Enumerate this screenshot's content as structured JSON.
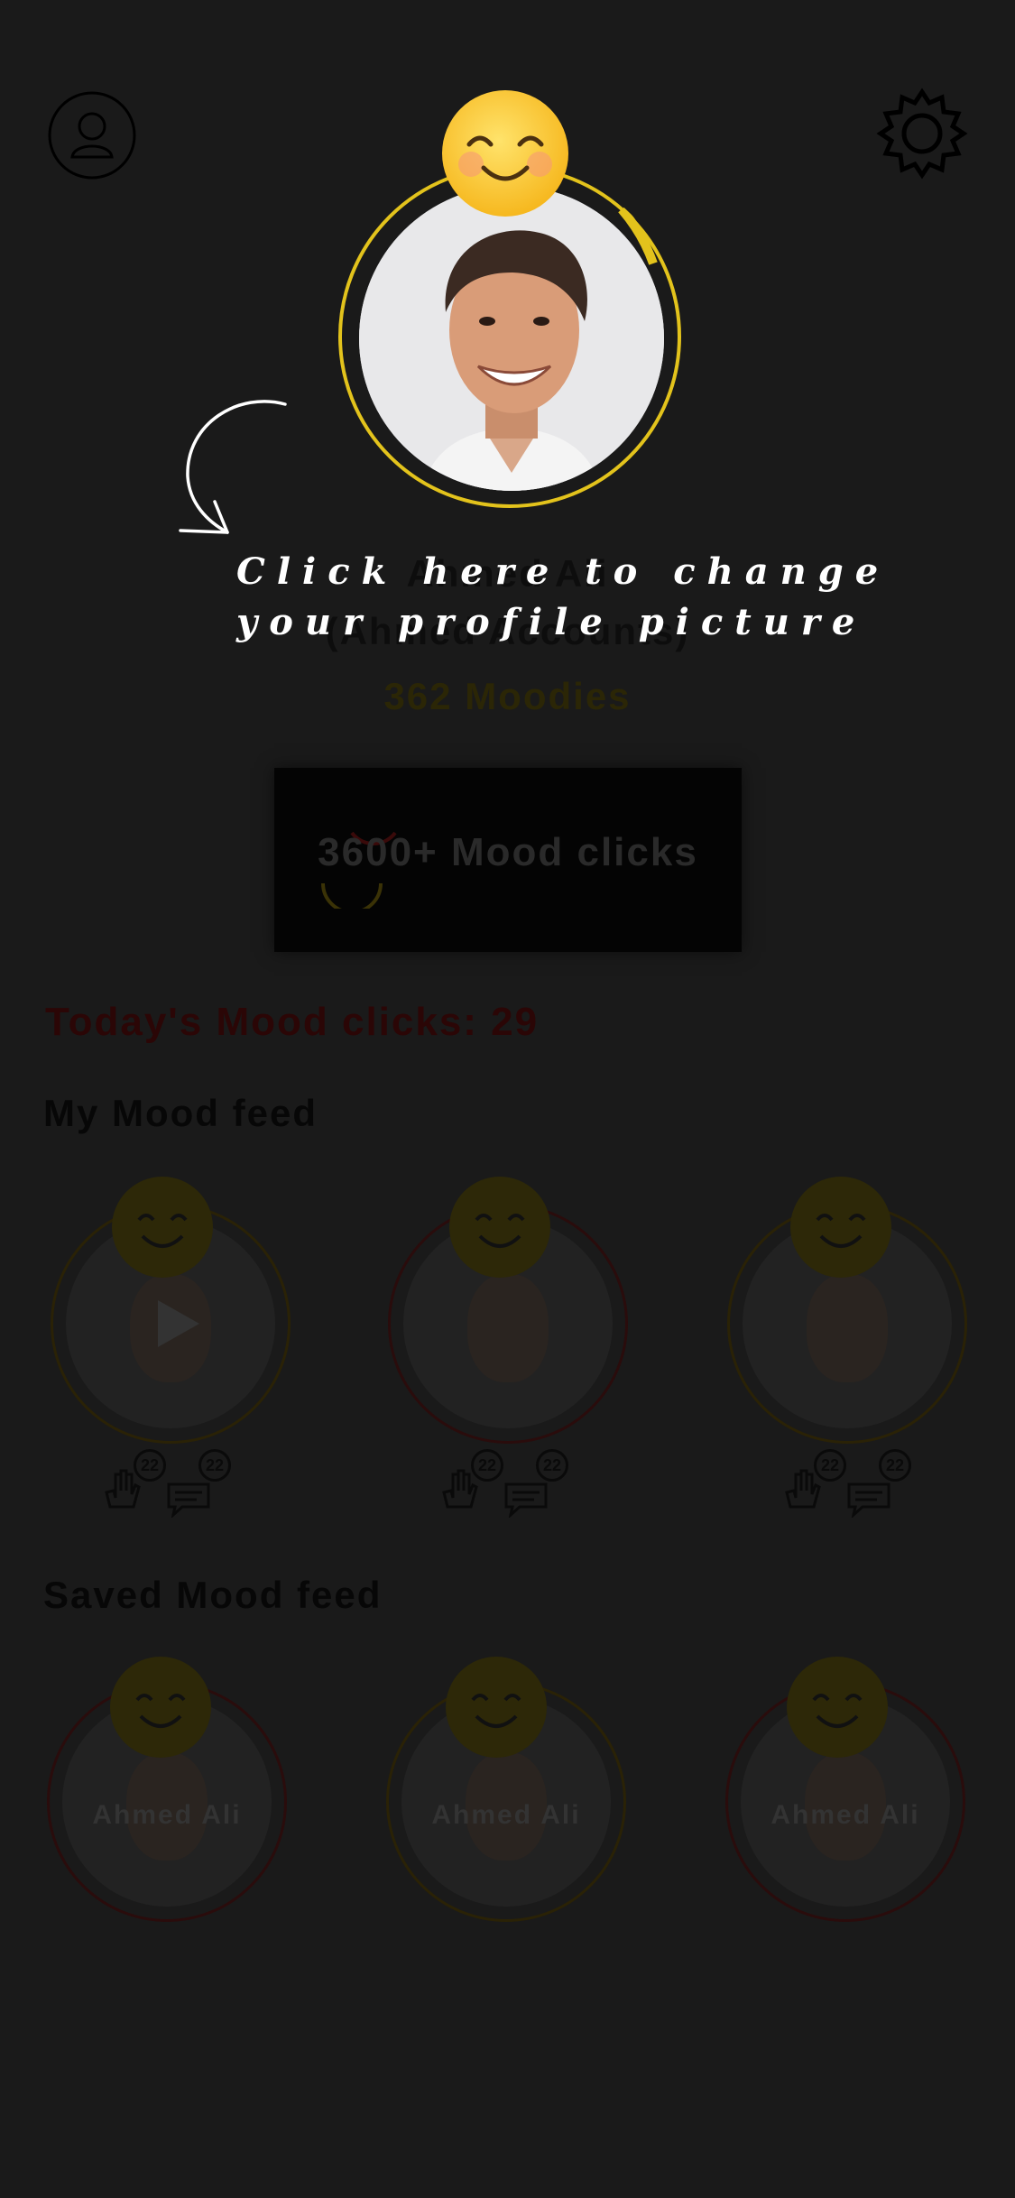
{
  "header": {
    "profile_icon": "person-icon",
    "settings_icon": "gear-icon"
  },
  "profile": {
    "name": "Ahmed Ali",
    "subtitle": "(Ahmed Accounts)",
    "moodies": "362 Moodies"
  },
  "hint": {
    "line1": "Click here to change",
    "line2": "your profile picture"
  },
  "stats": {
    "mood_clicks": "3600+ Mood clicks",
    "today": "Today's Mood clicks: 29"
  },
  "my_feed": {
    "title": "My Mood feed",
    "items": [
      {
        "likes": "22",
        "comments": "22"
      },
      {
        "likes": "22",
        "comments": "22"
      },
      {
        "likes": "22",
        "comments": "22"
      }
    ]
  },
  "saved_feed": {
    "title": "Saved Mood feed",
    "items": [
      {
        "label": "Ahmed Ali"
      },
      {
        "label": "Ahmed Ali"
      },
      {
        "label": "Ahmed Ali"
      }
    ]
  },
  "colors": {
    "background": "#1a1a1a",
    "accent_yellow": "#e3c31c",
    "hint_text": "#ffffff"
  }
}
